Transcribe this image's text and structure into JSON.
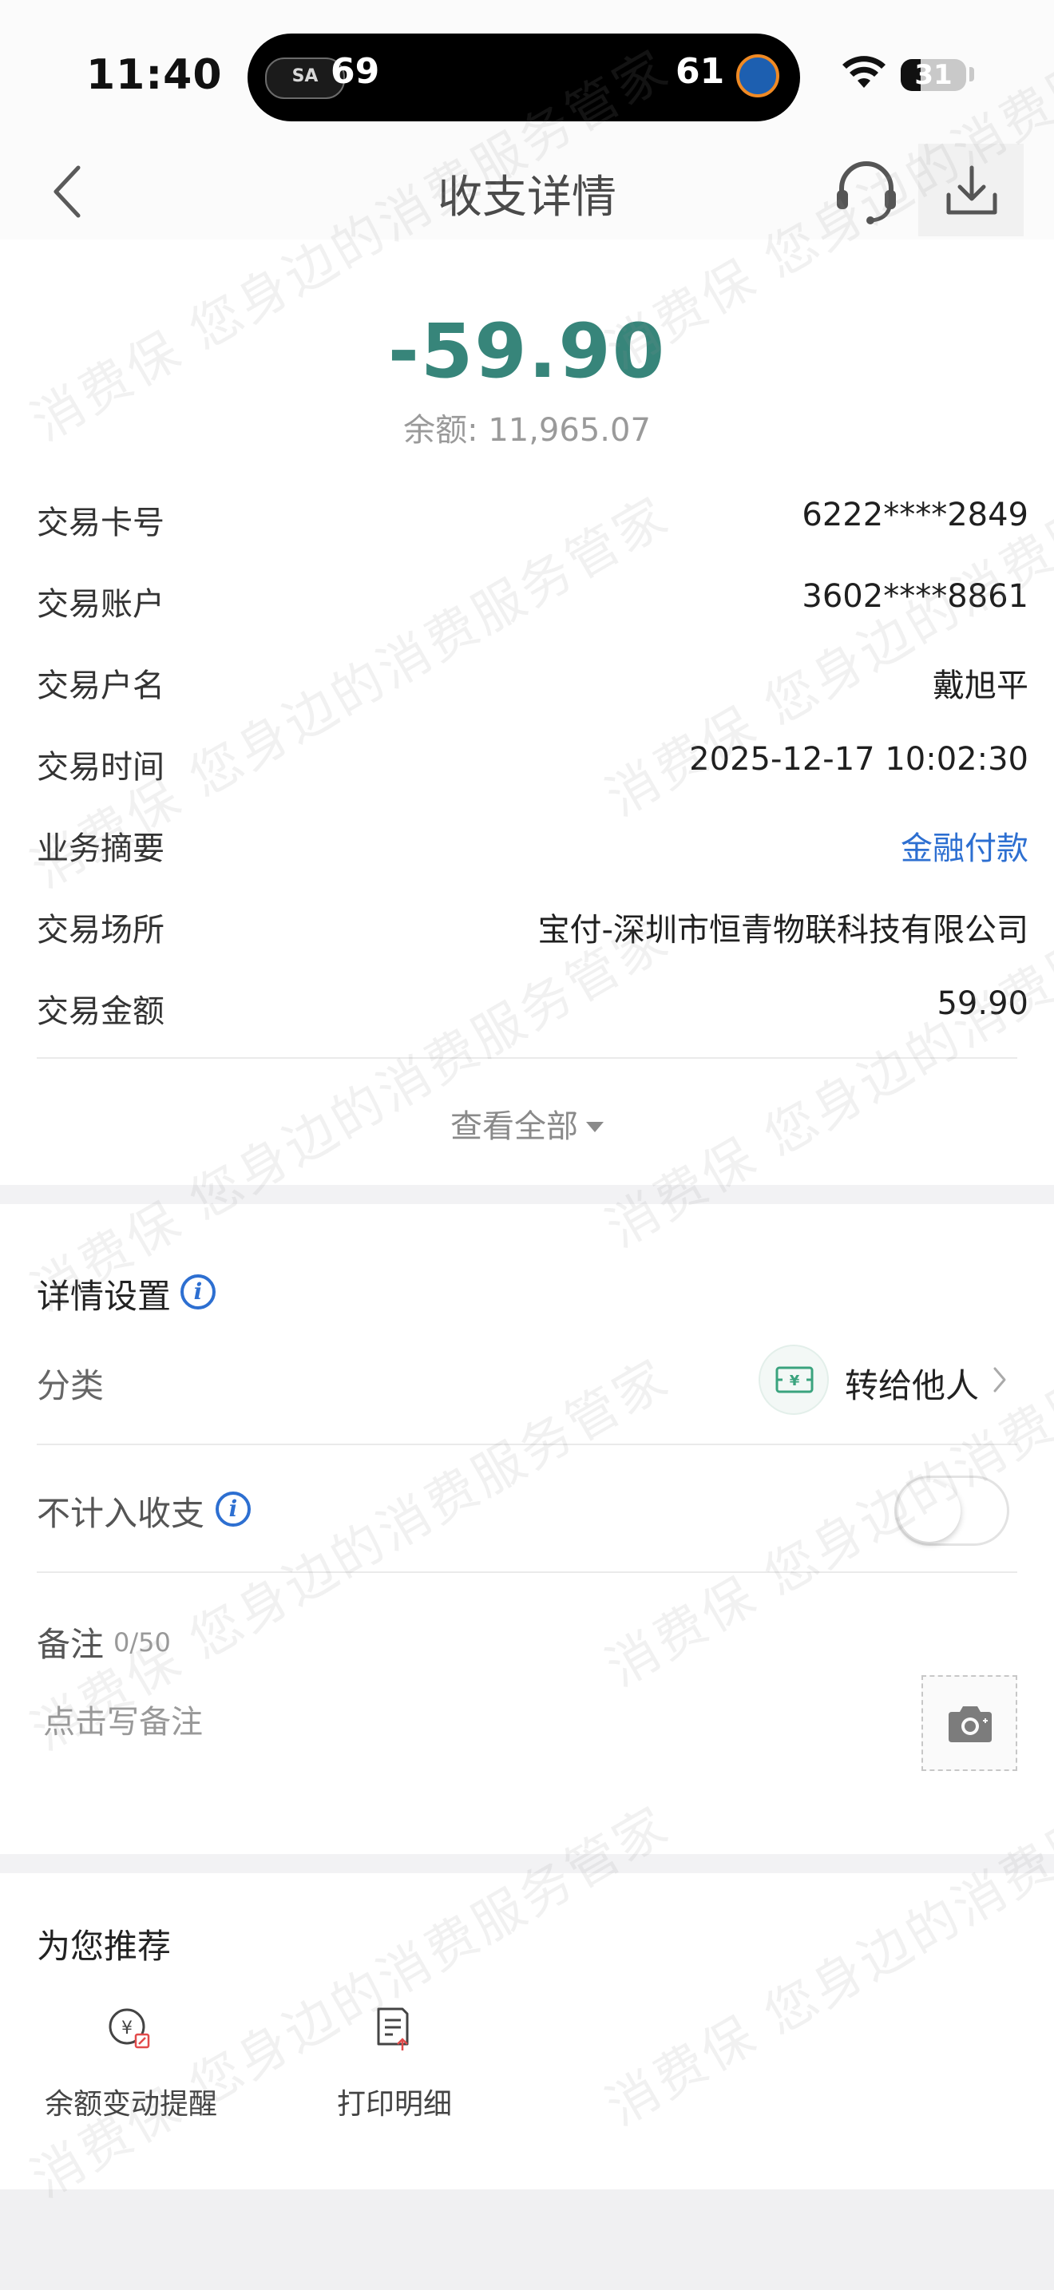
{
  "status_bar": {
    "time": "11:40",
    "live_activity": {
      "left_team_logo": "spurs-logo",
      "left_score": "69",
      "right_score": "61",
      "right_team_logo": "knicks-logo"
    },
    "battery_level": "31",
    "battery_fraction": 0.31
  },
  "nav": {
    "title": "收支详情",
    "back_icon": "chevron-left-icon",
    "service_icon": "headset-icon",
    "download_icon": "download-icon"
  },
  "summary": {
    "amount": "-59.90",
    "balance_label": "余额:",
    "balance_value": "11,965.07",
    "amount_color": "#37857a"
  },
  "details": [
    {
      "label": "交易卡号",
      "value": "6222****2849"
    },
    {
      "label": "交易账户",
      "value": "3602****8861"
    },
    {
      "label": "交易户名",
      "value": "戴旭平"
    },
    {
      "label": "交易时间",
      "value": "2025-12-17 10:02:30"
    },
    {
      "label": "业务摘要",
      "value": "金融付款",
      "link": true
    },
    {
      "label": "交易场所",
      "value": "宝付-深圳市恒青物联科技有限公司"
    },
    {
      "label": "交易金额",
      "value": "59.90"
    }
  ],
  "view_all": "查看全部",
  "settings": {
    "title": "详情设置",
    "category_label": "分类",
    "category_value": "转给他人",
    "category_icon": "money-transfer-icon",
    "exclude_label": "不计入收支",
    "exclude_enabled": false,
    "remark_label": "备注",
    "remark_count": "0/50",
    "remark_placeholder": "点击写备注",
    "photo_icon": "camera-icon"
  },
  "recommend": {
    "title": "为您推荐",
    "items": [
      {
        "label": "余额变动提醒",
        "icon": "balance-alert-icon"
      },
      {
        "label": "打印明细",
        "icon": "print-statement-icon"
      }
    ]
  },
  "watermark": "消费保 您身边的消费服务管家",
  "link_color": "#2d6fd1"
}
